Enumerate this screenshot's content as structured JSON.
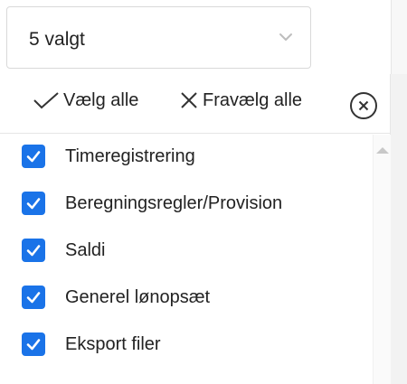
{
  "select": {
    "value": "5 valgt",
    "chevron_icon": "chevron-down-icon"
  },
  "actions": {
    "select_all_label": "Vælg alle",
    "select_all_icon": "checkmark-icon",
    "deselect_all_label": "Fravælg alle",
    "deselect_all_icon": "x-icon",
    "close_icon": "close-circle-icon"
  },
  "options": [
    {
      "label": "Timeregistrering",
      "checked": true
    },
    {
      "label": "Beregningsregler/Provision",
      "checked": true
    },
    {
      "label": "Saldi",
      "checked": true
    },
    {
      "label": "Generel lønopsæt",
      "checked": true
    },
    {
      "label": "Eksport filer",
      "checked": true
    }
  ],
  "colors": {
    "checkbox": "#1a73e8",
    "text": "#222222",
    "border": "#d9d9d9"
  }
}
